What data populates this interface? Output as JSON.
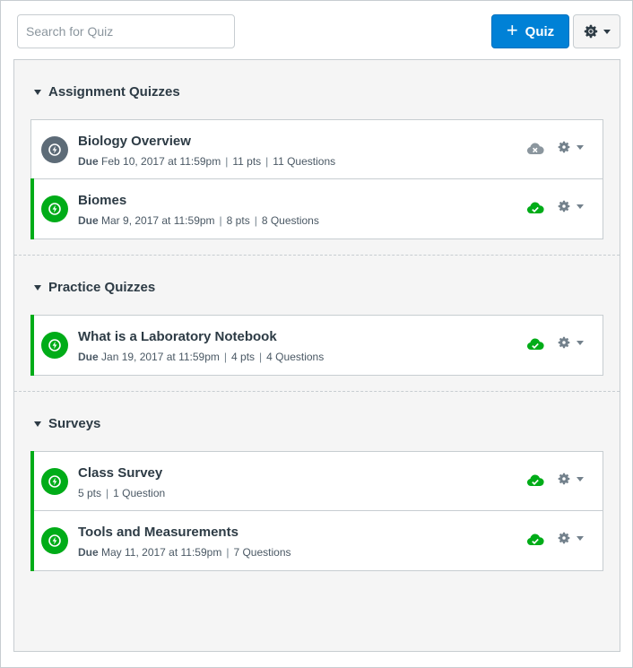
{
  "search": {
    "placeholder": "Search for Quiz"
  },
  "toolbar": {
    "add_quiz_label": "Quiz",
    "plus": "+"
  },
  "groups": [
    {
      "title": "Assignment Quizzes",
      "items": [
        {
          "title": "Biology Overview",
          "due_label": "Due",
          "due": "Feb 10, 2017 at 11:59pm",
          "pts": "11 pts",
          "questions": "11 Questions",
          "published": false
        },
        {
          "title": "Biomes",
          "due_label": "Due",
          "due": "Mar 9, 2017 at 11:59pm",
          "pts": "8 pts",
          "questions": "8 Questions",
          "published": true
        }
      ]
    },
    {
      "title": "Practice Quizzes",
      "items": [
        {
          "title": "What is a Laboratory Notebook",
          "due_label": "Due",
          "due": "Jan 19, 2017 at 11:59pm",
          "pts": "4 pts",
          "questions": "4 Questions",
          "published": true
        }
      ]
    },
    {
      "title": "Surveys",
      "items": [
        {
          "title": "Class Survey",
          "pts": "5 pts",
          "questions": "1 Question",
          "published": true
        },
        {
          "title": "Tools and Measurements",
          "due_label": "Due",
          "due": "May 11, 2017 at 11:59pm",
          "questions": "7 Questions",
          "published": true
        }
      ]
    }
  ],
  "separator": "|",
  "colors": {
    "primary": "#0081d6",
    "published": "#00ac18",
    "unpublished": "#5d6b77",
    "text": "#2d3b45"
  }
}
